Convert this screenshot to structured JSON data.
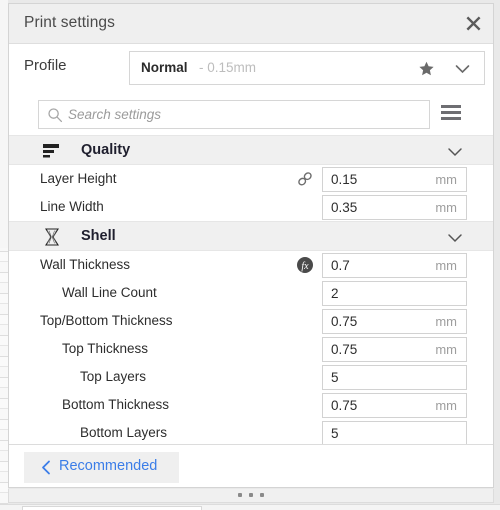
{
  "window": {
    "title": "Print settings",
    "close_icon": "close-icon"
  },
  "profile": {
    "label": "Profile",
    "name": "Normal",
    "detail": "- 0.15mm",
    "star_icon": "star-icon",
    "chevron_icon": "chevron-down-icon"
  },
  "search": {
    "placeholder": "Search settings",
    "icon": "search-icon",
    "menu_icon": "hamburger-menu-icon"
  },
  "categories": [
    {
      "name": "Quality",
      "icon": "layers-icon",
      "chevron": "chevron-down-icon",
      "expanded": true,
      "rows": [
        {
          "label": "Layer Height",
          "indent": 0,
          "value": "0.15",
          "unit": "mm",
          "badge": "link-icon"
        },
        {
          "label": "Line Width",
          "indent": 0,
          "value": "0.35",
          "unit": "mm",
          "badge": ""
        }
      ]
    },
    {
      "name": "Shell",
      "icon": "shell-icon",
      "chevron": "chevron-down-icon",
      "expanded": true,
      "rows": [
        {
          "label": "Wall Thickness",
          "indent": 0,
          "value": "0.7",
          "unit": "mm",
          "badge": "function-icon"
        },
        {
          "label": "Wall Line Count",
          "indent": 1,
          "value": "2",
          "unit": "",
          "badge": ""
        },
        {
          "label": "Top/Bottom Thickness",
          "indent": 0,
          "value": "0.75",
          "unit": "mm",
          "badge": ""
        },
        {
          "label": "Top Thickness",
          "indent": 1,
          "value": "0.75",
          "unit": "mm",
          "badge": ""
        },
        {
          "label": "Top Layers",
          "indent": 2,
          "value": "5",
          "unit": "",
          "badge": ""
        },
        {
          "label": "Bottom Thickness",
          "indent": 1,
          "value": "0.75",
          "unit": "mm",
          "badge": ""
        },
        {
          "label": "Bottom Layers",
          "indent": 2,
          "value": "5",
          "unit": "",
          "badge": ""
        }
      ]
    }
  ],
  "footer": {
    "recommended_label": "Recommended",
    "back_icon": "chevron-left-icon"
  },
  "colors": {
    "scrollbar": "#191952",
    "link_text": "#3b7de8",
    "category_bg": "#f0f0f0"
  }
}
